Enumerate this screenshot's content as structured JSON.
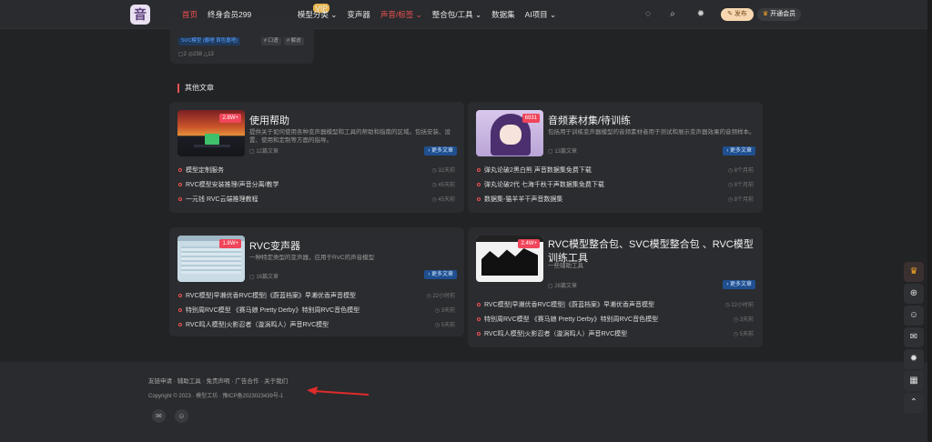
{
  "header": {
    "logo_text": "音",
    "nav": [
      {
        "label": "首页",
        "active": true
      },
      {
        "label": "终身会员299"
      },
      {
        "label": "模型分类 ⌄"
      },
      {
        "label": "变声器"
      },
      {
        "label": "声音/标签 ⌄",
        "highlight": true
      },
      {
        "label": "整合包/工具 ⌄"
      },
      {
        "label": "数据集"
      },
      {
        "label": "AI项目 ⌄"
      }
    ],
    "vip_badge": "VIP",
    "publish_label": "发布",
    "open_vip_label": "开通会员"
  },
  "top_card": {
    "tags": [
      "SVC模型 (藤哩 首色蔓嗒)",
      "# 口语",
      "# 解说"
    ],
    "stats": "▢2   ◎238   △13"
  },
  "section_title": "其他文章",
  "cards": [
    {
      "title": "使用帮助",
      "badge": "2.8W+",
      "desc": "提供关于如何使用各种变声器模型和工具的帮助和指南的区域。包括安装、设置、使用和定制等方面的指导。",
      "count": "▢ 12篇文章",
      "more": "› 更多文章",
      "items": [
        {
          "text": "模型定制服务",
          "time": "◷ 32天前"
        },
        {
          "text": "RVC模型安装推理/声音分离/教学",
          "time": "◷ 45天前"
        },
        {
          "text": "一元钱 RVC云端推理教程",
          "time": "◷ 45天前"
        }
      ]
    },
    {
      "title": "音频素材集/待训练",
      "badge": "6931",
      "desc": "包括用于训练变声器模型的音频素材者用于测试和展示变声器效果的音频样本。",
      "count": "▢ 13篇文章",
      "more": "› 更多文章",
      "items": [
        {
          "text": "弹丸论破2黑白熊 声音数据集免费下载",
          "time": "◷ 8个月前"
        },
        {
          "text": "弹丸论破2代 七海千秋干声数据集免费下载",
          "time": "◷ 8个月前"
        },
        {
          "text": "数据集-猫羊羊干声音数据集",
          "time": "◷ 8个月前"
        }
      ]
    },
    {
      "title": "RVC变声器",
      "badge": "1.8W+",
      "desc": "一种特定类型的变声器，应用于RVC的声音模型",
      "count": "▢ 16篇文章",
      "more": "› 更多文章",
      "items": [
        {
          "text": "RVC模型|早濑优香RVC模型|《蔚蓝档案》早濑优香声音模型",
          "time": "◷ 22小时前"
        },
        {
          "text": "特别周RVC模型 《赛马娘 Pretty Derby》特别周RVC音色模型",
          "time": "◷ 3天前"
        },
        {
          "text": "RVC鸣人模型|火影忍者（漩涡鸣人）声音RVC模型",
          "time": "◷ 5天前"
        }
      ]
    },
    {
      "title": "RVC模型整合包、SVC模型整合包 、RVC模型训练工具",
      "badge": "2.4W+",
      "desc": "一些辅助工具",
      "count": "▢ 26篇文章",
      "more": "› 更多文章",
      "items": [
        {
          "text": "RVC模型|早濑优香RVC模型|《蔚蓝档案》早濑优香声音模型",
          "time": "◷ 22小时前"
        },
        {
          "text": "特别周RVC模型 《赛马娘 Pretty Derby》特别周RVC音色模型",
          "time": "◷ 3天前"
        },
        {
          "text": "RVC鸣人模型|火影忍者（漩涡鸣人）声音RVC模型",
          "time": "◷ 5天前"
        }
      ]
    }
  ],
  "footer": {
    "links": "友链申请 · 辅助工具 · 免责声明 · 广告合作 · 关于我们",
    "copyright": "Copyright © 2023 · 模型工坊 · 豫ICP备2023023439号-1"
  },
  "colors": {
    "accent": "#f05252",
    "background": "#222325",
    "card": "#2b2c2f"
  }
}
